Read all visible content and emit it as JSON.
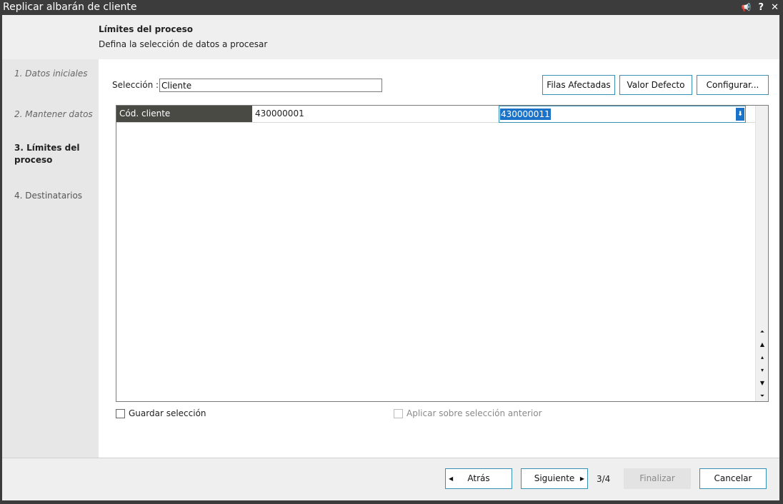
{
  "window": {
    "title": "Replicar albarán de cliente",
    "controls": {
      "pin": "📢",
      "help": "?",
      "close": "✕"
    }
  },
  "header": {
    "title": "Límites del proceso",
    "subtitle": "Defina la selección de datos a procesar"
  },
  "steps": [
    {
      "label": "1. Datos iniciales",
      "state": "done"
    },
    {
      "label": "2. Mantener datos",
      "state": "done"
    },
    {
      "label": "3. Límites del",
      "label2": "proceso",
      "state": "active"
    },
    {
      "label": "4. Destinatarios",
      "state": "pending"
    }
  ],
  "selection": {
    "label": "Selección :",
    "value": "Cliente"
  },
  "toolbar": {
    "affected_rows": "Filas Afectadas",
    "default_value": "Valor Defecto",
    "configure": "Configurar..."
  },
  "grid": {
    "rows": [
      {
        "field": "Cód. cliente",
        "from": "430000001",
        "to": "430000011"
      }
    ]
  },
  "scroll_glyphs": {
    "first": "⏶",
    "page_up": "▲",
    "up": "▴",
    "down": "▾",
    "page_down": "▼",
    "last": "⏷"
  },
  "options": {
    "save_selection": {
      "label": "Guardar selección",
      "checked": false,
      "enabled": true
    },
    "apply_previous": {
      "label": "Aplicar sobre selección anterior",
      "checked": false,
      "enabled": false
    }
  },
  "footer": {
    "back": "Atrás",
    "next": "Siguiente",
    "page": "3/4",
    "finish": "Finalizar",
    "cancel": "Cancelar"
  },
  "colors": {
    "accent": "#3a8fb5",
    "selection": "#1a73c9",
    "titlebar": "#3c3c3c",
    "grid_label_bg": "#4a4a44"
  }
}
